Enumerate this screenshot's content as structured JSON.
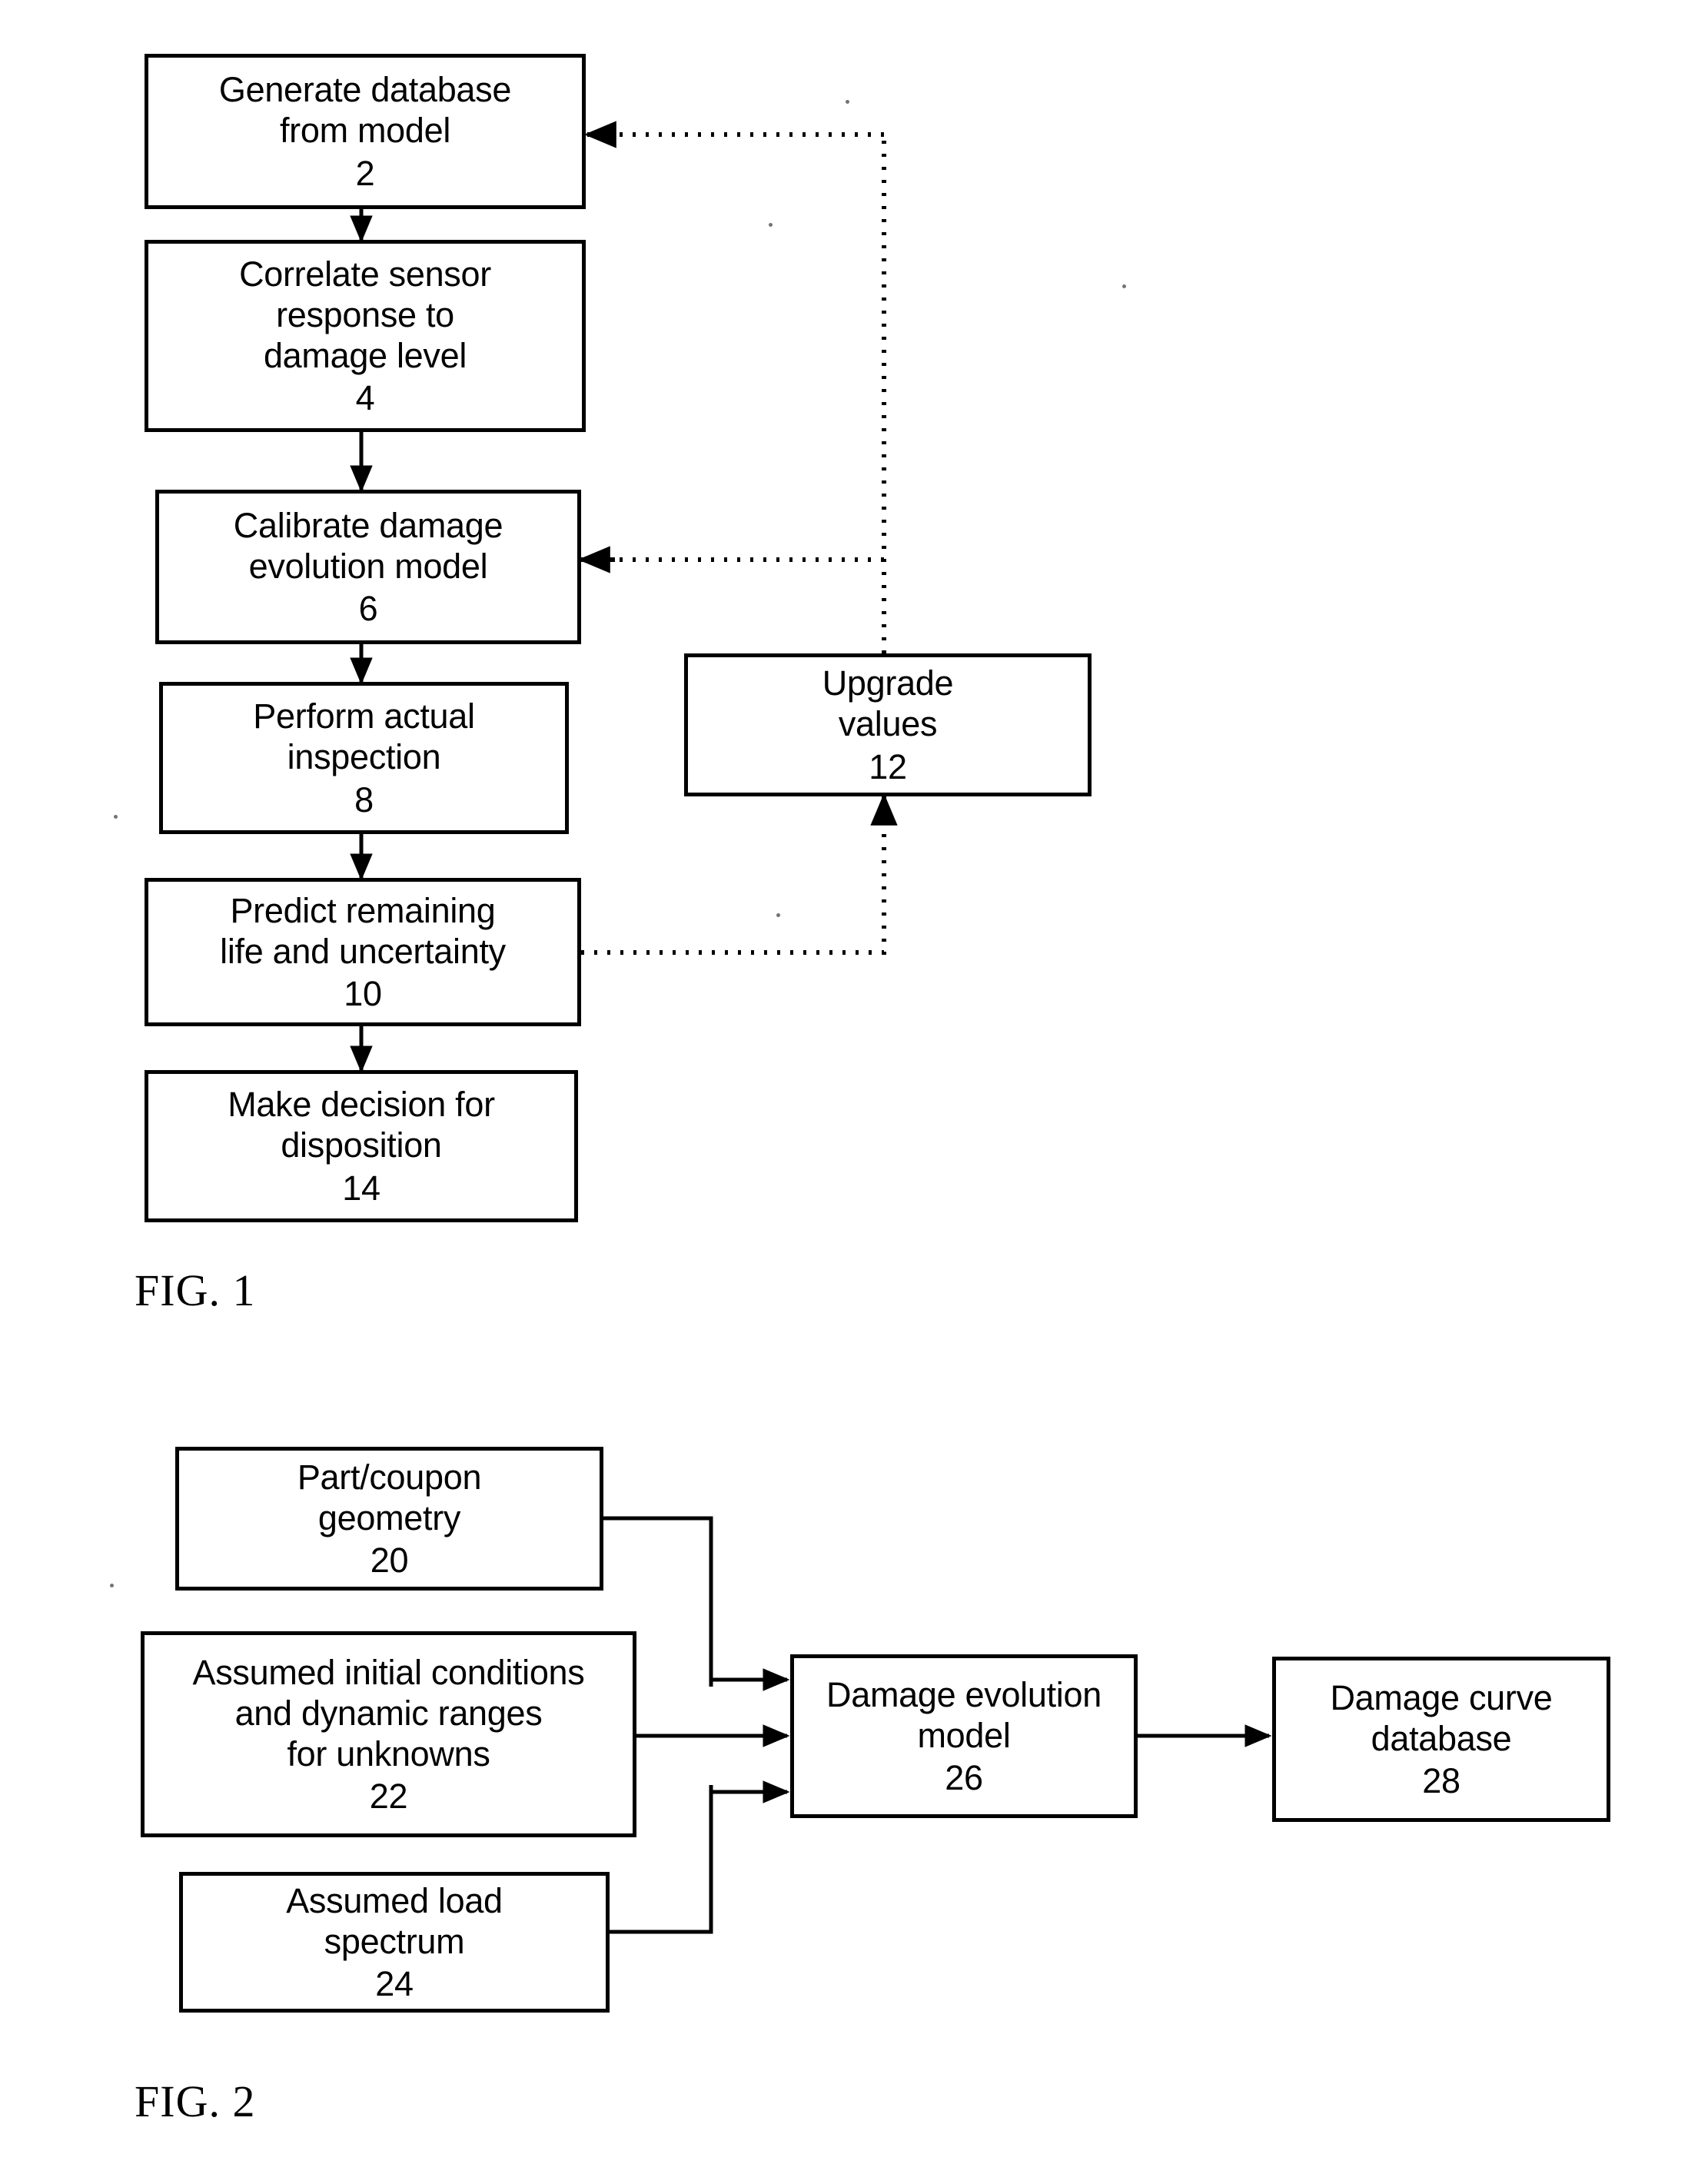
{
  "document": {
    "type": "patent-drawing-sheet",
    "figures": [
      {
        "id": "fig1",
        "caption": "FIG. 1",
        "nodes": [
          {
            "id": "n2",
            "label": "Generate database\nfrom model",
            "ref": "2"
          },
          {
            "id": "n4",
            "label": "Correlate sensor\nresponse to\ndamage level",
            "ref": "4"
          },
          {
            "id": "n6",
            "label": "Calibrate damage\nevolution model",
            "ref": "6"
          },
          {
            "id": "n8",
            "label": "Perform actual\ninspection",
            "ref": "8"
          },
          {
            "id": "n10",
            "label": "Predict remaining\nlife and uncertainty",
            "ref": "10"
          },
          {
            "id": "n14",
            "label": "Make decision for\ndisposition",
            "ref": "14"
          },
          {
            "id": "n12",
            "label": "Upgrade\nvalues",
            "ref": "12"
          }
        ],
        "edges": [
          {
            "from": "n2",
            "to": "n4",
            "style": "solid"
          },
          {
            "from": "n4",
            "to": "n6",
            "style": "solid"
          },
          {
            "from": "n6",
            "to": "n8",
            "style": "solid"
          },
          {
            "from": "n8",
            "to": "n10",
            "style": "solid"
          },
          {
            "from": "n10",
            "to": "n14",
            "style": "solid"
          },
          {
            "from": "n10",
            "to": "n12",
            "style": "dotted"
          },
          {
            "from": "n12",
            "to": "n2",
            "style": "dotted"
          },
          {
            "from": "n12",
            "to": "n6",
            "style": "dotted"
          }
        ]
      },
      {
        "id": "fig2",
        "caption": "FIG. 2",
        "nodes": [
          {
            "id": "n20",
            "label": "Part/coupon\ngeometry",
            "ref": "20"
          },
          {
            "id": "n22",
            "label": "Assumed initial conditions\nand dynamic ranges\nfor unknowns",
            "ref": "22"
          },
          {
            "id": "n24",
            "label": "Assumed load\nspectrum",
            "ref": "24"
          },
          {
            "id": "n26",
            "label": "Damage evolution\nmodel",
            "ref": "26"
          },
          {
            "id": "n28",
            "label": "Damage curve\ndatabase",
            "ref": "28"
          }
        ],
        "edges": [
          {
            "from": "n20",
            "to": "n26",
            "style": "solid"
          },
          {
            "from": "n22",
            "to": "n26",
            "style": "solid"
          },
          {
            "from": "n24",
            "to": "n26",
            "style": "solid"
          },
          {
            "from": "n26",
            "to": "n28",
            "style": "solid"
          }
        ]
      }
    ]
  },
  "colors": {
    "ink": "#000000",
    "paper": "#ffffff"
  }
}
